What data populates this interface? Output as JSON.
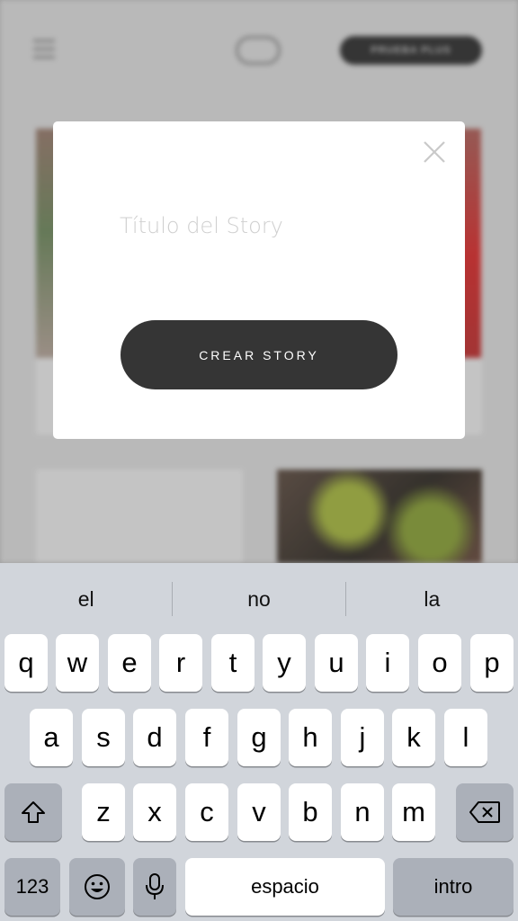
{
  "background": {
    "header_button_label": "PRUEBA PLUS"
  },
  "modal": {
    "title_placeholder": "Título del Story",
    "create_button_label": "CREAR STORY"
  },
  "keyboard": {
    "predictions": [
      "el",
      "no",
      "la"
    ],
    "row1": [
      "q",
      "w",
      "e",
      "r",
      "t",
      "y",
      "u",
      "i",
      "o",
      "p"
    ],
    "row2": [
      "a",
      "s",
      "d",
      "f",
      "g",
      "h",
      "j",
      "k",
      "l"
    ],
    "row3": [
      "z",
      "x",
      "c",
      "v",
      "b",
      "n",
      "m"
    ],
    "numbers_key": "123",
    "space_key": "espacio",
    "return_key": "intro"
  },
  "colors": {
    "button_dark": "#353535",
    "keyboard_bg": "#d1d5db",
    "key_dark": "#abb0b9"
  }
}
